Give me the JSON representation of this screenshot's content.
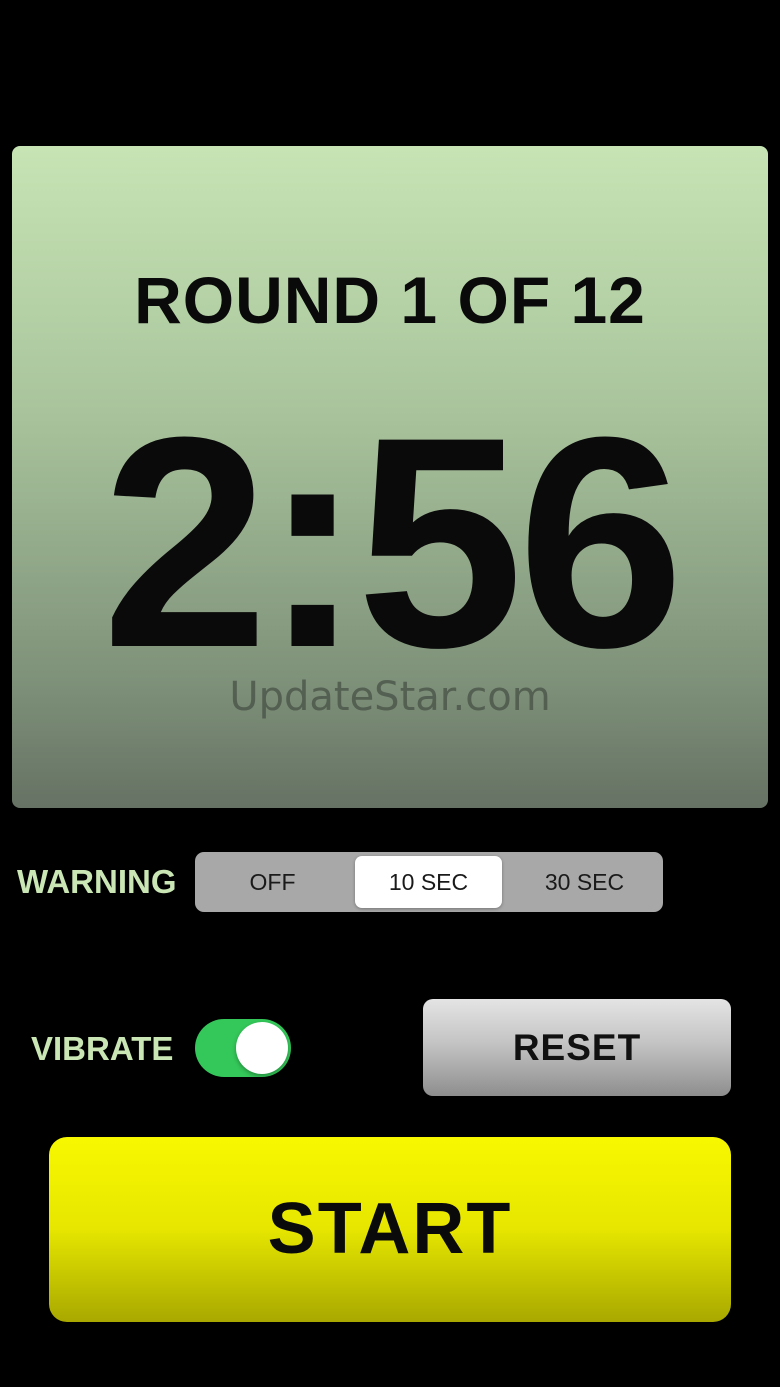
{
  "timer": {
    "round_label": "ROUND 1 OF 12",
    "time": "2:56",
    "watermark": "UpdateStar.com"
  },
  "warning": {
    "label": "WARNING",
    "options": [
      "OFF",
      "10 SEC",
      "30 SEC"
    ],
    "selected": "10 SEC"
  },
  "vibrate": {
    "label": "VIBRATE",
    "enabled": true
  },
  "buttons": {
    "reset": "RESET",
    "start": "START"
  },
  "colors": {
    "panel_top": "#c6e4b4",
    "panel_bottom": "#667264",
    "label_green": "#c9e6b4",
    "toggle_on": "#34c759",
    "start_yellow": "#f8f800"
  }
}
